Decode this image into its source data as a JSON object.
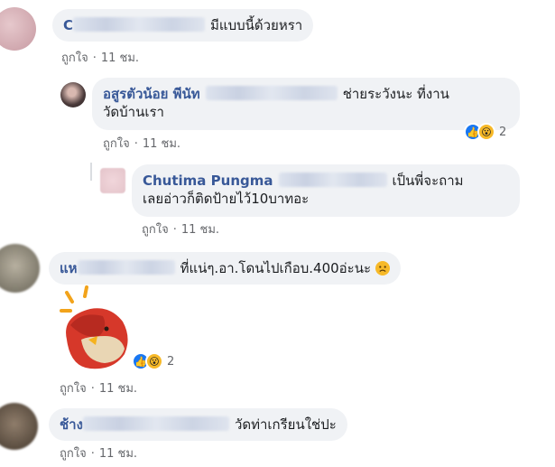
{
  "comments": [
    {
      "name": "C",
      "text": "มีแบบนี้ด้วยหรา",
      "like": "ถูกใจ",
      "time": "11 ชม."
    },
    {
      "name": "อสูรตัวน้อย พีนัท",
      "text1": "ช่ายระวังนะ ที่งาน",
      "text2": "วัดบ้านเรา",
      "like": "ถูกใจ",
      "time": "11 ชม.",
      "reactions": "2"
    },
    {
      "name": "Chutima Pungma",
      "text1": "เป็นพี่จะถาม",
      "text2": "เลยอ่าวก็ติดป้ายไว้10บาทอะ",
      "like": "ถูกใจ",
      "time": "11 ชม."
    },
    {
      "name": "แห",
      "text": "ที่แน่ๆ.อา.โดนไปเกือบ.400อ่ะนะ",
      "like": "ถูกใจ",
      "time": "11 ชม.",
      "sticker_reactions": "2"
    },
    {
      "name": "ช้าง",
      "text": "วัดท่าเกรียนใช่ปะ",
      "like": "ถูกใจ",
      "time": "11 ชม."
    }
  ],
  "icons": {
    "like": "thumbs-up-icon",
    "wow": "wow-emoji-icon",
    "sad": "sad-emoji-icon"
  },
  "colors": {
    "name": "#385898",
    "bubble": "#f0f2f5",
    "like": "#1877f2",
    "wow": "#f7b928"
  }
}
